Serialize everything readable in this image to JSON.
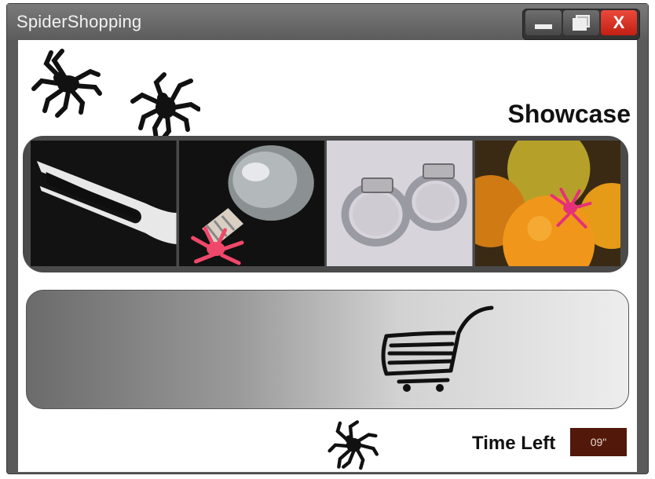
{
  "window": {
    "title": "SpiderShopping",
    "close_label": "X",
    "icons": [
      "minimize-icon",
      "maximize-icon",
      "close-icon"
    ]
  },
  "header": {
    "title": "Showcase"
  },
  "showcase": {
    "items": [
      {
        "name": "fork-item",
        "icon": "fork"
      },
      {
        "name": "lightbulb-item",
        "icon": "lightbulb"
      },
      {
        "name": "hose-clamps-item",
        "icon": "hose-clamps"
      },
      {
        "name": "oranges-item",
        "icon": "oranges"
      }
    ]
  },
  "cart": {
    "icon": "shopping-cart-icon"
  },
  "timer": {
    "label": "Time Left",
    "value": "09\""
  },
  "decor": {
    "icons": [
      "spider-icon",
      "spider-icon",
      "spider-icon"
    ]
  },
  "colors": {
    "titlebar": "#5c5c5c",
    "close": "#d8291c",
    "timer_bg": "#521809",
    "showcase_frame": "#4a4a4a"
  }
}
